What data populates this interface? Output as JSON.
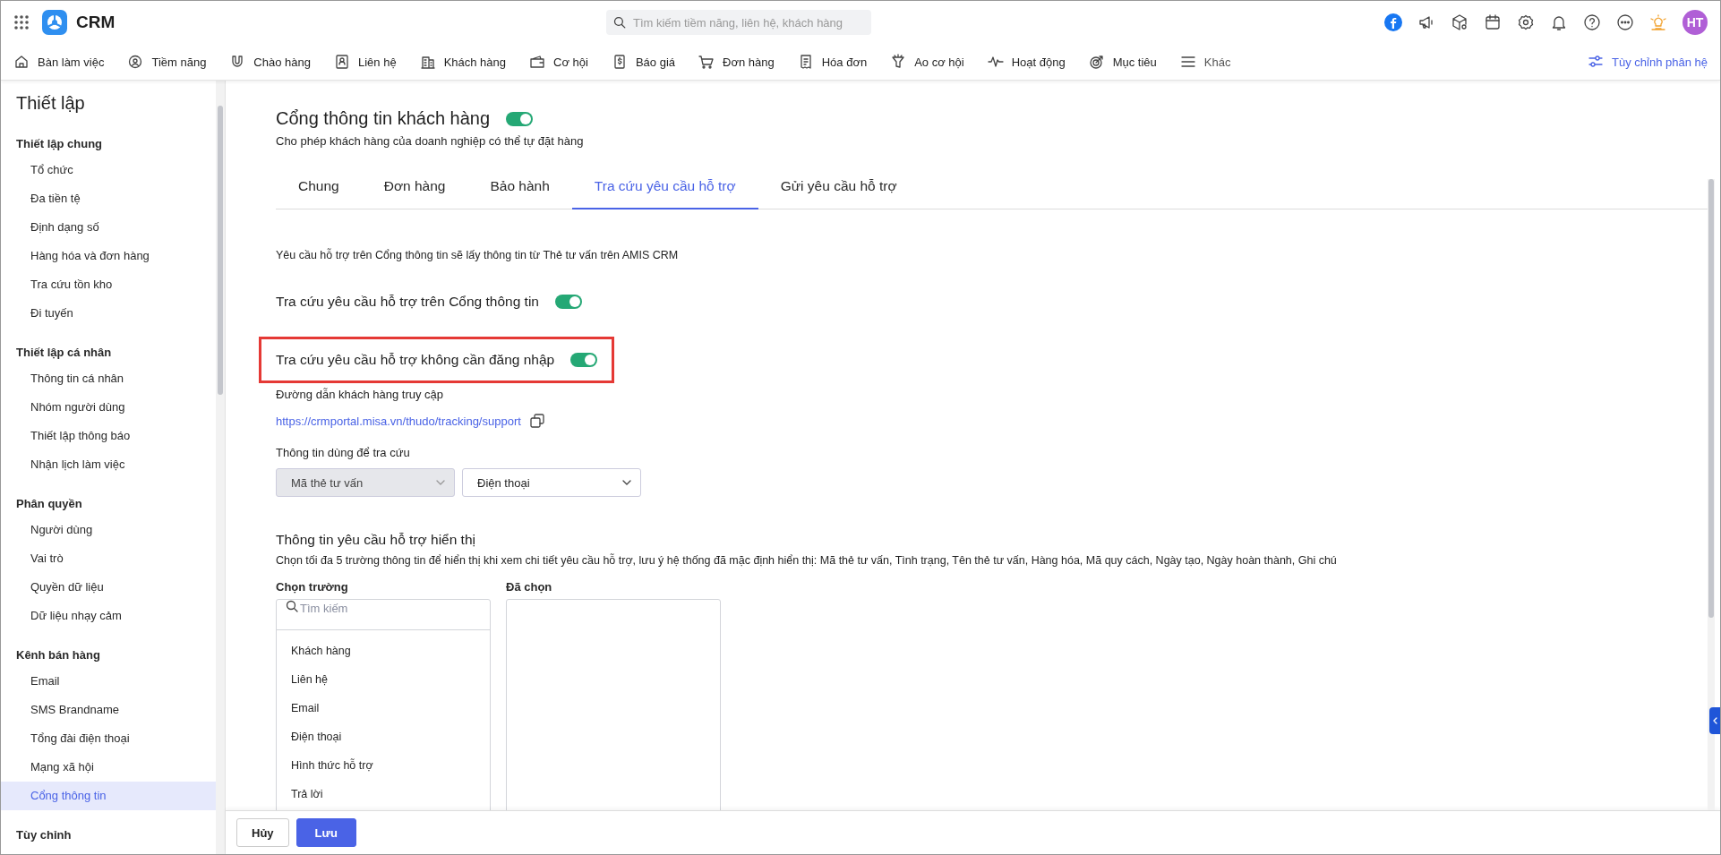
{
  "app": {
    "name": "CRM"
  },
  "search": {
    "placeholder": "Tìm kiếm tiềm năng, liên hệ, khách hàng"
  },
  "user": {
    "initials": "HT"
  },
  "nav": {
    "items": [
      {
        "label": "Bàn làm việc"
      },
      {
        "label": "Tiềm năng"
      },
      {
        "label": "Chào hàng"
      },
      {
        "label": "Liên hệ"
      },
      {
        "label": "Khách hàng"
      },
      {
        "label": "Cơ hội"
      },
      {
        "label": "Báo giá"
      },
      {
        "label": "Đơn hàng"
      },
      {
        "label": "Hóa đơn"
      },
      {
        "label": "Ao cơ hội"
      },
      {
        "label": "Hoạt động"
      },
      {
        "label": "Mục tiêu"
      }
    ],
    "more": "Khác",
    "customize": "Tùy chỉnh phân hệ"
  },
  "sidebar": {
    "title": "Thiết lập",
    "groups": [
      {
        "title": "Thiết lập chung",
        "items": [
          {
            "label": "Tổ chức",
            "selected": false
          },
          {
            "label": "Đa tiền tệ",
            "selected": false
          },
          {
            "label": "Định dạng số",
            "selected": false
          },
          {
            "label": "Hàng hóa và đơn hàng",
            "selected": false
          },
          {
            "label": "Tra cứu tồn kho",
            "selected": false
          },
          {
            "label": "Đi tuyến",
            "selected": false
          }
        ]
      },
      {
        "title": "Thiết lập cá nhân",
        "items": [
          {
            "label": "Thông tin cá nhân",
            "selected": false
          },
          {
            "label": "Nhóm người dùng",
            "selected": false
          },
          {
            "label": "Thiết lập thông báo",
            "selected": false
          },
          {
            "label": "Nhận lịch làm việc",
            "selected": false
          }
        ]
      },
      {
        "title": "Phân quyền",
        "items": [
          {
            "label": "Người dùng",
            "selected": false
          },
          {
            "label": "Vai trò",
            "selected": false
          },
          {
            "label": "Quyền dữ liệu",
            "selected": false
          },
          {
            "label": "Dữ liệu nhạy cảm",
            "selected": false
          }
        ]
      },
      {
        "title": "Kênh bán hàng",
        "items": [
          {
            "label": "Email",
            "selected": false
          },
          {
            "label": "SMS Brandname",
            "selected": false
          },
          {
            "label": "Tổng đài điện thoại",
            "selected": false
          },
          {
            "label": "Mạng xã hội",
            "selected": false
          },
          {
            "label": "Cổng thông tin",
            "selected": true
          }
        ]
      },
      {
        "title": "Tùy chỉnh"
      }
    ]
  },
  "page": {
    "title": "Cổng thông tin khách hàng",
    "enabled": true,
    "subtitle": "Cho phép khách hàng của doanh nghiệp có thể tự đặt hàng",
    "tabs": [
      {
        "label": "Chung",
        "selected": false
      },
      {
        "label": "Đơn hàng",
        "selected": false
      },
      {
        "label": "Bảo hành",
        "selected": false
      },
      {
        "label": "Tra cứu yêu cầu hỗ trợ",
        "selected": true
      },
      {
        "label": "Gửi yêu cầu hỗ trợ",
        "selected": false
      }
    ],
    "intro": "Yêu cầu hỗ trợ trên Cổng thông tin sẽ lấy thông tin từ Thẻ tư vấn trên AMIS CRM",
    "settings": [
      {
        "label": "Tra cứu yêu cầu hỗ trợ trên Cổng thông tin",
        "on": true,
        "highlighted": false
      },
      {
        "label": "Tra cứu yêu cầu hỗ trợ không cần đăng nhập",
        "on": true,
        "highlighted": true
      }
    ],
    "link_label": "Đường dẫn khách hàng truy cập",
    "link": "https://crmportal.misa.vn/thudo/tracking/support",
    "lookup_label": "Thông tin dùng để tra cứu",
    "lookup_fields": [
      {
        "value": "Mã thẻ tư vấn",
        "disabled": true
      },
      {
        "value": "Điện thoại",
        "disabled": false
      }
    ],
    "display_title": "Thông tin yêu cầu hỗ trợ hiển thị",
    "display_note": "Chọn tối đa 5 trường thông tin để hiển thị khi xem chi tiết yêu cầu hỗ trợ, lưu ý hệ thống đã mặc định hiển thị: Mã thẻ tư vấn, Tình trạng, Tên thẻ tư vấn, Hàng hóa, Mã quy cách, Ngày tạo, Ngày hoàn thành, Ghi chú",
    "available": {
      "label": "Chọn trường",
      "search_placeholder": "Tìm kiếm",
      "items": [
        "Khách hàng",
        "Liên hệ",
        "Email",
        "Điện thoại",
        "Hình thức hỗ trợ",
        "Trả lời"
      ]
    },
    "chosen": {
      "label": "Đã chọn"
    }
  },
  "footer": {
    "buttons": [
      {
        "label": "Hủy",
        "kind": "secondary"
      },
      {
        "label": "Lưu",
        "kind": "primary"
      }
    ]
  }
}
